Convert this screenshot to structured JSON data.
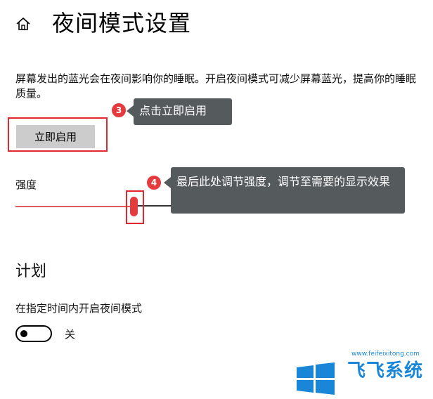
{
  "header": {
    "home_icon": "home-icon",
    "title": "夜间模式设置"
  },
  "description": "屏幕发出的蓝光会在夜间影响你的睡眠。开启夜间模式可减少屏幕蓝光，提高你的睡眠质量。",
  "turn_on_button": {
    "label": "立即启用"
  },
  "annotations": {
    "step3": {
      "number": "3",
      "text": "点击立即启用"
    },
    "step4": {
      "number": "4",
      "text": "最后此处调节强度，调节至需要的显示效果"
    }
  },
  "strength": {
    "label": "强度",
    "value_fraction": 0.3
  },
  "schedule": {
    "heading": "计划",
    "label": "在指定时间内开启夜间模式",
    "toggle_state": "关"
  },
  "watermark": {
    "url": "www.feifeixitong.com",
    "brand": "飞飞系统"
  },
  "colors": {
    "accent": "#e53a3e",
    "callout_bg": "#555a5c",
    "button_bg": "#cccccc",
    "watermark_blue": "#1a86d8"
  }
}
